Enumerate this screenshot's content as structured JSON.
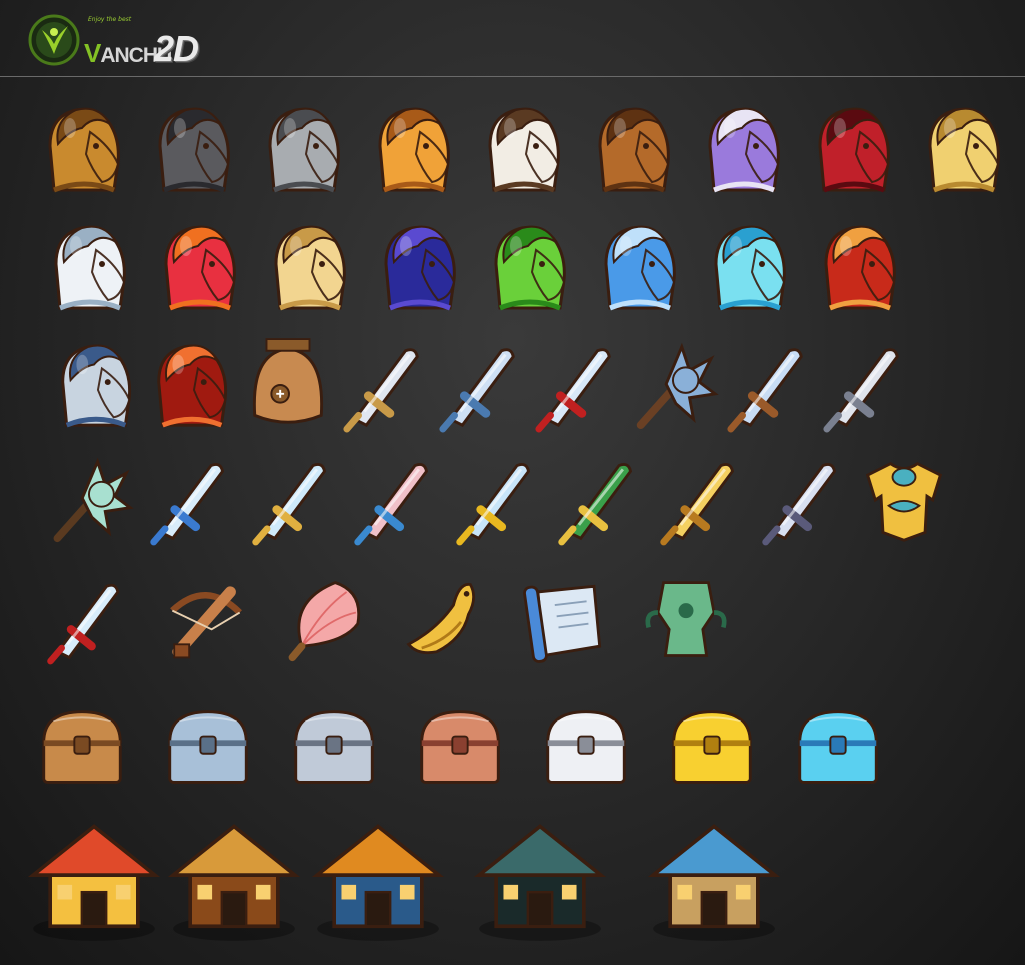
{
  "header": {
    "brand_letter": "V",
    "brand_rest": "ANCHU",
    "tagline": "Enjoy the best",
    "edition": "2D"
  },
  "palette": {
    "background": "#2a2a2a",
    "rule": "#6a6a6a",
    "brand_green": "#84c225",
    "outline": "#3a1e10"
  },
  "rows": [
    {
      "name": "horses-basic",
      "items": [
        {
          "icon": "horse-bay-icon",
          "kind": "horse",
          "colors": [
            "#c98a2e",
            "#7a4a16"
          ]
        },
        {
          "icon": "horse-black-icon",
          "kind": "horse",
          "colors": [
            "#5a5a5e",
            "#2a2a2e"
          ]
        },
        {
          "icon": "horse-grey-icon",
          "kind": "horse",
          "colors": [
            "#a8acb0",
            "#4a4c50"
          ]
        },
        {
          "icon": "horse-orange-icon",
          "kind": "horse",
          "colors": [
            "#f0a238",
            "#a85a18"
          ]
        },
        {
          "icon": "horse-white-brown-icon",
          "kind": "horse",
          "colors": [
            "#f2ede4",
            "#5a3a22"
          ]
        },
        {
          "icon": "horse-chestnut-icon",
          "kind": "horse",
          "colors": [
            "#b46a2a",
            "#5e3212"
          ]
        },
        {
          "icon": "horse-purple-icon",
          "kind": "horse",
          "colors": [
            "#9a7adc",
            "#e8e4f4"
          ]
        },
        {
          "icon": "horse-crimson-icon",
          "kind": "horse",
          "colors": [
            "#c0202a",
            "#5a0a10"
          ]
        },
        {
          "icon": "horse-golden-icon",
          "kind": "horse",
          "colors": [
            "#f0d070",
            "#b88a30"
          ]
        }
      ]
    },
    {
      "name": "horses-rare",
      "items": [
        {
          "icon": "horse-silver-icon",
          "kind": "horse",
          "colors": [
            "#eef2f6",
            "#9ab0c4"
          ]
        },
        {
          "icon": "horse-flame-icon",
          "kind": "horse",
          "colors": [
            "#e83040",
            "#f07020"
          ]
        },
        {
          "icon": "horse-palomino-icon",
          "kind": "horse",
          "colors": [
            "#f2d590",
            "#c89a48"
          ]
        },
        {
          "icon": "horse-navy-icon",
          "kind": "horse",
          "colors": [
            "#2a2a9a",
            "#5a4ad0"
          ]
        },
        {
          "icon": "horse-green-icon",
          "kind": "horse",
          "colors": [
            "#6ad03a",
            "#2a8a1a"
          ]
        },
        {
          "icon": "horse-azure-icon",
          "kind": "horse",
          "colors": [
            "#4a9ae8",
            "#bfe0fa"
          ]
        },
        {
          "icon": "horse-ice-icon",
          "kind": "horse",
          "colors": [
            "#7ae0f0",
            "#2aa0d0"
          ]
        },
        {
          "icon": "horse-red-hare-icon",
          "kind": "horse",
          "colors": [
            "#c82a1a",
            "#f0a040"
          ]
        }
      ]
    },
    {
      "name": "mounts-and-blades",
      "items": [
        {
          "icon": "horse-skeleton-icon",
          "kind": "horse",
          "colors": [
            "#c8d4e0",
            "#3a5a8a"
          ]
        },
        {
          "icon": "horse-inferno-icon",
          "kind": "horse",
          "colors": [
            "#a01a10",
            "#f07030"
          ]
        },
        {
          "icon": "helmet-bronze-icon",
          "kind": "helmet",
          "colors": [
            "#c88a50",
            "#8a5a2a"
          ]
        },
        {
          "icon": "sword-falchion-icon",
          "kind": "sword",
          "colors": [
            "#e0e6f0",
            "#c89a48"
          ]
        },
        {
          "icon": "sword-curved-icon",
          "kind": "sword",
          "colors": [
            "#cfe0f4",
            "#4a7ab0"
          ]
        },
        {
          "icon": "sword-red-hilt-icon",
          "kind": "sword",
          "colors": [
            "#d8e8f8",
            "#c02020"
          ]
        },
        {
          "icon": "mace-spiked-icon",
          "kind": "mace",
          "colors": [
            "#8ab0d8",
            "#6a4024"
          ]
        },
        {
          "icon": "trident-icon",
          "kind": "sword",
          "colors": [
            "#c8dcf4",
            "#9a5a2a"
          ]
        },
        {
          "icon": "spear-steel-icon",
          "kind": "sword",
          "colors": [
            "#e0e4ec",
            "#7a8090"
          ]
        }
      ]
    },
    {
      "name": "weapons",
      "items": [
        {
          "icon": "club-ice-icon",
          "kind": "mace",
          "colors": [
            "#a8e0d0",
            "#5a3a20"
          ]
        },
        {
          "icon": "sword-crystal-icon",
          "kind": "sword",
          "colors": [
            "#d8ecfa",
            "#3a7ad0"
          ]
        },
        {
          "icon": "glaive-blue-icon",
          "kind": "sword",
          "colors": [
            "#cfeafa",
            "#e0b040"
          ]
        },
        {
          "icon": "sword-rose-icon",
          "kind": "sword",
          "colors": [
            "#f0c0c8",
            "#3a8ad0"
          ]
        },
        {
          "icon": "sword-golden-guard-icon",
          "kind": "sword",
          "colors": [
            "#c8e4f8",
            "#e8b820"
          ]
        },
        {
          "icon": "glaive-jade-icon",
          "kind": "sword",
          "colors": [
            "#3aa04a",
            "#e8c040"
          ]
        },
        {
          "icon": "sword-gold-icon",
          "kind": "sword",
          "colors": [
            "#f4d060",
            "#b87a20"
          ]
        },
        {
          "icon": "sword-sabre-icon",
          "kind": "sword",
          "colors": [
            "#d8dff0",
            "#5a5a7a"
          ]
        },
        {
          "icon": "armor-gold-icon",
          "kind": "armor",
          "colors": [
            "#f0c040",
            "#4ab0c0"
          ]
        }
      ]
    },
    {
      "name": "items",
      "items": [
        {
          "icon": "dual-blades-icon",
          "kind": "sword",
          "colors": [
            "#d8ecfa",
            "#c02020"
          ]
        },
        {
          "icon": "crossbow-icon",
          "kind": "crossbow",
          "colors": [
            "#c8804a",
            "#8a4a22"
          ]
        },
        {
          "icon": "feather-fan-icon",
          "kind": "fan",
          "colors": [
            "#f4a8a8",
            "#e06a6a"
          ]
        },
        {
          "icon": "golden-bird-icon",
          "kind": "bird",
          "colors": [
            "#f0c040",
            "#b07a18"
          ]
        },
        {
          "icon": "scroll-icon",
          "kind": "scroll",
          "colors": [
            "#4a8ad8",
            "#dce8f4"
          ]
        },
        {
          "icon": "jade-vessel-icon",
          "kind": "vessel",
          "colors": [
            "#6ab88a",
            "#2a6a4a"
          ]
        }
      ]
    },
    {
      "name": "chests",
      "items": [
        {
          "icon": "chest-wood-icon",
          "kind": "chest",
          "colors": [
            "#c88a4a",
            "#7a4a22"
          ]
        },
        {
          "icon": "chest-stone-icon",
          "kind": "chest",
          "colors": [
            "#a8c0d8",
            "#5a7088"
          ]
        },
        {
          "icon": "chest-iron-icon",
          "kind": "chest",
          "colors": [
            "#c0cad8",
            "#6a7484"
          ]
        },
        {
          "icon": "chest-copper-icon",
          "kind": "chest",
          "colors": [
            "#d88a6a",
            "#8a4030"
          ]
        },
        {
          "icon": "chest-silver-icon",
          "kind": "chest",
          "colors": [
            "#eef0f4",
            "#8a8e98"
          ]
        },
        {
          "icon": "chest-gold-icon",
          "kind": "chest",
          "colors": [
            "#f8d030",
            "#b08010"
          ]
        },
        {
          "icon": "chest-crystal-icon",
          "kind": "chest",
          "colors": [
            "#5ad0f0",
            "#2a7ab8"
          ]
        }
      ]
    },
    {
      "name": "buildings",
      "items": [
        {
          "icon": "building-temple-icon",
          "kind": "building",
          "colors": [
            "#e04a2a",
            "#f4c040"
          ]
        },
        {
          "icon": "building-tavern-icon",
          "kind": "building",
          "colors": [
            "#d89a3a",
            "#8a4a1a"
          ]
        },
        {
          "icon": "building-cave-icon",
          "kind": "building",
          "colors": [
            "#e08a20",
            "#2a5a8a"
          ]
        },
        {
          "icon": "building-fortress-icon",
          "kind": "building",
          "colors": [
            "#3a6a6a",
            "#1a2a2a"
          ]
        },
        {
          "icon": "building-market-icon",
          "kind": "building",
          "colors": [
            "#4a9ad0",
            "#c8a060"
          ]
        }
      ]
    }
  ]
}
